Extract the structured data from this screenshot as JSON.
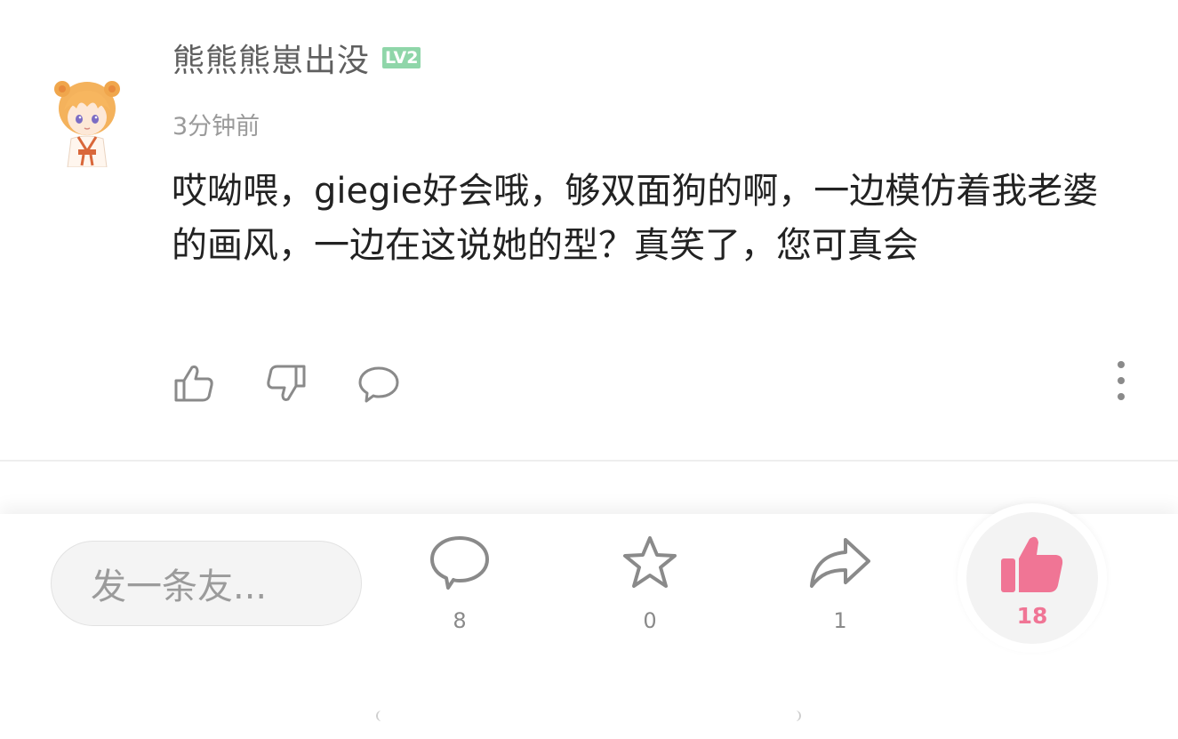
{
  "comment": {
    "username": "熊熊熊崽出没",
    "level_badge": "LV2",
    "timestamp": "3分钟前",
    "body": "哎呦喂，giegie好会哦，够双面狗的啊，一边模仿着我老婆的画风，一边在这说她的型？真笑了，您可真会",
    "avatar_icon": "avatar-anime-girl-orange-hair",
    "actions": {
      "like_icon": "thumbs-up-outline-icon",
      "dislike_icon": "thumbs-down-outline-icon",
      "reply_icon": "speech-bubble-icon",
      "more_icon": "vertical-dots-icon"
    }
  },
  "bottom_bar": {
    "reply_placeholder": "发一条友...",
    "comment_count": "8",
    "favorite_count": "0",
    "share_count": "1",
    "like_count": "18"
  },
  "colors": {
    "level_badge": "#8fd6a9",
    "like_accent": "#f07595",
    "icon_gray": "#8a8a8a",
    "text_primary": "#222222"
  }
}
